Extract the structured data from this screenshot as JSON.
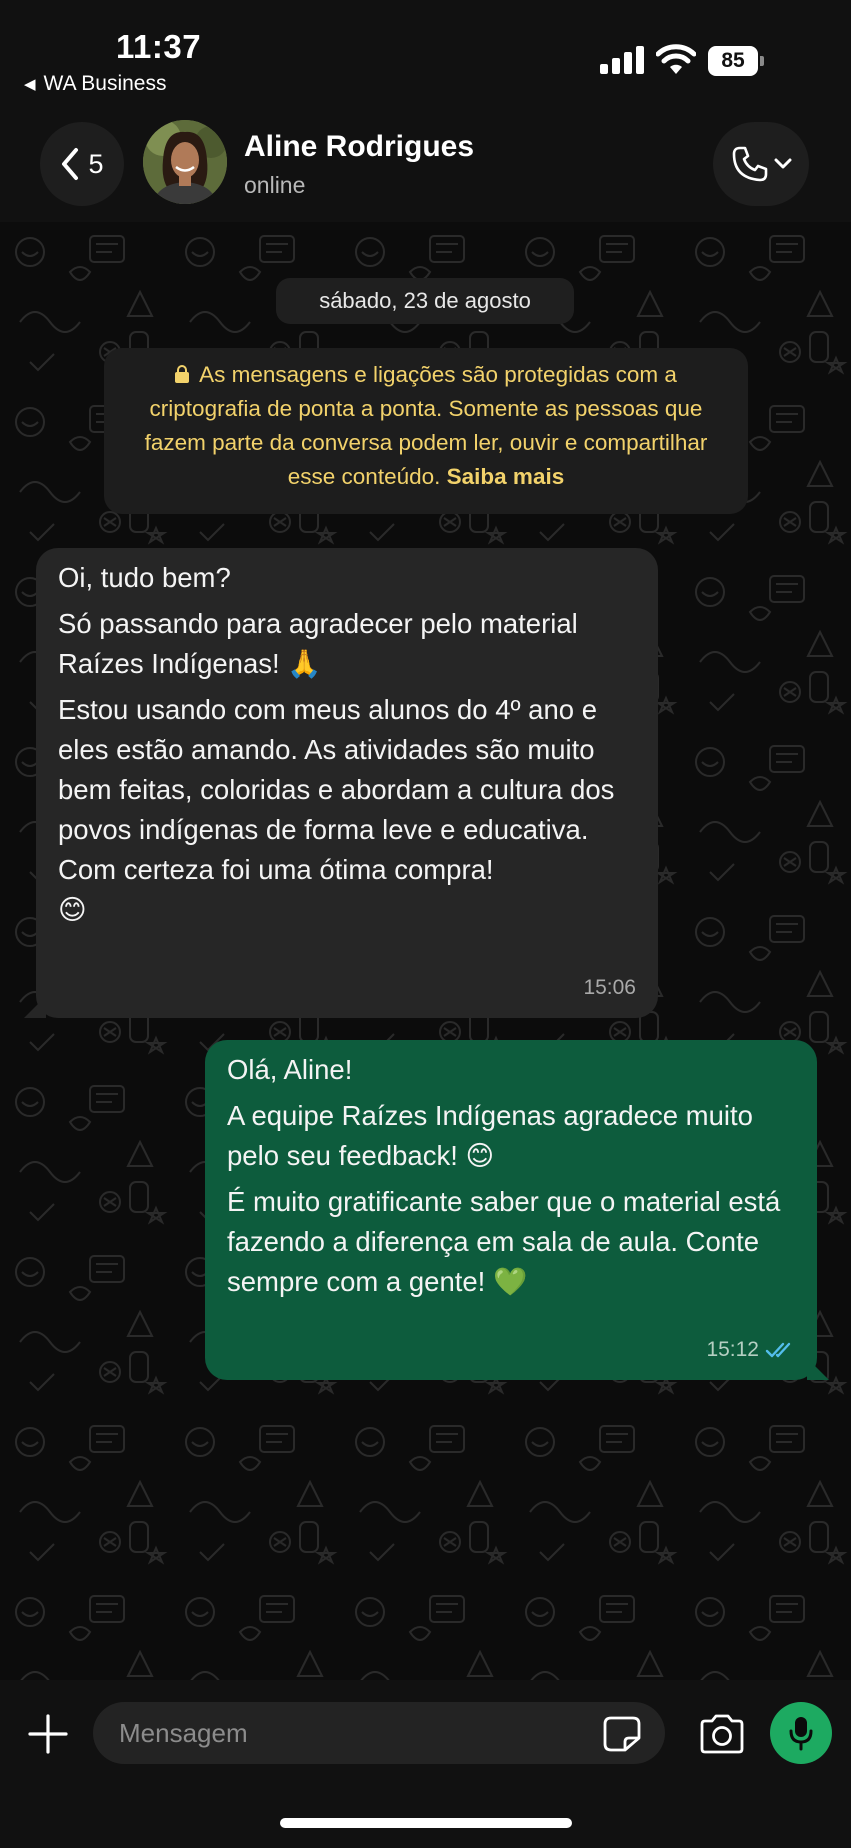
{
  "status_bar": {
    "time": "11:37",
    "back_app": "WA Business",
    "battery": "85"
  },
  "header": {
    "back_count": "5",
    "contact_name": "Aline Rodrigues",
    "contact_status": "online",
    "icons": [
      "chevron-left-icon",
      "phone-icon",
      "chevron-down-icon"
    ]
  },
  "chat": {
    "date_chip": "sábado, 23 de agosto",
    "encryption_text": "As mensagens e ligações são protegidas com a criptografia de ponta a ponta. Somente as pessoas que fazem parte da conversa podem ler, ouvir e compartilhar esse conteúdo.",
    "encryption_link": "Saiba mais",
    "messages": [
      {
        "direction": "incoming",
        "paragraphs": [
          "Oi, tudo bem?",
          "Só passando para agradecer pelo material Raízes Indígenas! 🙏",
          "Estou usando com meus alunos do 4º ano e eles estão amando. As atividades são muito bem feitas, coloridas e abordam a cultura dos povos indígenas de forma leve e educativa.",
          "Com certeza foi uma ótima compra!",
          "😊"
        ],
        "time": "15:06"
      },
      {
        "direction": "outgoing",
        "paragraphs": [
          "Olá, Aline!",
          "A equipe Raízes Indígenas agradece muito pelo seu feedback! 😊",
          "É muito gratificante saber que o material está fazendo a diferença em sala de aula. Conte sempre com a gente! 💚"
        ],
        "time": "15:12",
        "read_receipt": "double-check-icon"
      }
    ]
  },
  "composer": {
    "placeholder": "Mensagem",
    "icons": [
      "plus-icon",
      "sticker-icon",
      "camera-icon",
      "microphone-icon"
    ]
  },
  "colors": {
    "background": "#0b0b0b",
    "incoming_bubble": "#262626",
    "outgoing_bubble": "#0d5c3d",
    "notice_text": "#f2d26b",
    "mic_button": "#1daa61",
    "read_check": "#53bdeb"
  }
}
